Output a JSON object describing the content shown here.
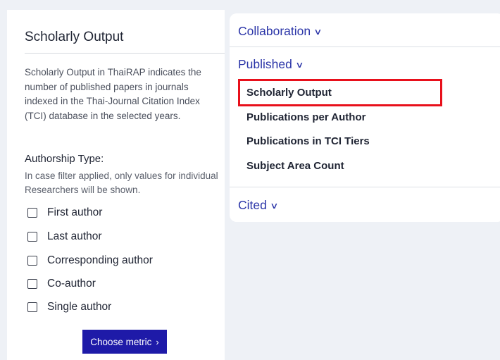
{
  "left_panel": {
    "title": "Scholarly Output",
    "description": "Scholarly Output in ThaiRAP indicates the number of published papers in journals indexed in the Thai-Journal Citation Index (TCI) database in the selected years.",
    "authorship_title": "Authorship Type:",
    "authorship_note": "In case filter applied, only values for individual Researchers will be shown.",
    "checkboxes": [
      {
        "label": "First author",
        "checked": false
      },
      {
        "label": "Last author",
        "checked": false
      },
      {
        "label": "Corresponding author",
        "checked": false
      },
      {
        "label": "Co-author",
        "checked": false
      },
      {
        "label": "Single author",
        "checked": false
      }
    ],
    "button_label": "Choose metric",
    "button_chevron": "›"
  },
  "right_panel": {
    "sections": [
      {
        "label": "Collaboration",
        "caret": "∨"
      },
      {
        "label": "Published",
        "caret": "∨"
      },
      {
        "label": "Cited",
        "caret": "∨"
      }
    ],
    "published_items": [
      "Scholarly Output",
      "Publications per Author",
      "Publications in TCI Tiers",
      "Subject Area Count"
    ],
    "selected_item": "Scholarly Output"
  },
  "colors": {
    "accent": "#2b35a8",
    "button": "#1e1aa8",
    "highlight": "#e8101b"
  }
}
